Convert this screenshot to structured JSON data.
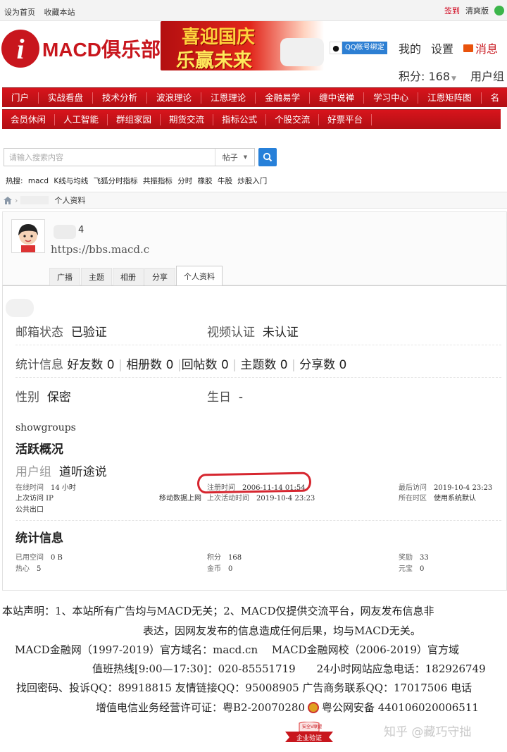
{
  "topbar": {
    "left_links": [
      "设为首页",
      "收藏本站"
    ],
    "signin": "签到",
    "theme": "清爽版"
  },
  "header": {
    "logo_letter": "i",
    "logo_text": "MACD俱乐部",
    "banner_line1": "喜迎国庆",
    "banner_line2": "乐赢未来",
    "qq_bind": "QQ帐号绑定",
    "my": "我的",
    "settings": "设置",
    "messages": "消息",
    "points": "积分: 168",
    "usergroup": "用户组"
  },
  "nav_primary": [
    "门户",
    "实战看盘",
    "技术分析",
    "波浪理论",
    "江恩理论",
    "金融易学",
    "缠中说禅",
    "学习中心",
    "江恩矩阵图",
    "名"
  ],
  "nav_secondary": [
    "会员休闲",
    "人工智能",
    "群组家园",
    "期货交流",
    "指标公式",
    "个股交流",
    "好票平台"
  ],
  "search": {
    "placeholder": "请输入搜索内容",
    "type": "帖子"
  },
  "hot": {
    "label": "热搜:",
    "words": [
      "macd",
      "K线与均线",
      "飞狐分时指标",
      "共振指标",
      "分时",
      "橡胶",
      "牛股",
      "炒股入门"
    ]
  },
  "breadcrumb": {
    "current": "个人资料"
  },
  "profile": {
    "name_suffix": "4",
    "url": "https://bbs.macd.c",
    "tabs": [
      "广播",
      "主题",
      "相册",
      "分享",
      "个人资料"
    ],
    "active_tab": "个人资料"
  },
  "details": {
    "email_label": "邮箱状态",
    "email_value": "已验证",
    "video_label": "视频认证",
    "video_value": "未认证",
    "stats_label": "统计信息",
    "stats": [
      "好友数 0",
      "相册数 0",
      "回帖数 0",
      "主题数 0",
      "分享数 0"
    ],
    "gender_label": "性别",
    "gender_value": "保密",
    "birthday_label": "生日",
    "birthday_value": "-",
    "showgroups": "showgroups",
    "activity_title": "活跃概况",
    "group_label": "用户组",
    "group_value": "道听途说",
    "online_label": "在线时间",
    "online_value": "14 小时",
    "reg_label": "注册时间",
    "reg_value": "2006-11-14 01:54",
    "last_visit_label": "最后访问",
    "last_visit_value": "2019-10-4 23:23",
    "last_ip_label": "上次访问 IP",
    "mobile_label": "移动数据上网",
    "last_active_label": "上次活动时间",
    "last_active_value": "2019-10-4 23:23",
    "region_label": "所在时区",
    "region_value": "使用系统默认",
    "public_exit": "公共出口",
    "stats_title": "统计信息",
    "space_label": "已用空间",
    "space_value": "0 B",
    "points_label": "积分",
    "points_value": "168",
    "reward_label": "奖励",
    "reward_value": "33",
    "enthusiasm_label": "热心",
    "enthusiasm_value": "5",
    "gold_label": "金币",
    "gold_value": "0",
    "treasure_label": "元宝",
    "treasure_value": "0"
  },
  "footer": {
    "line1": "本站声明：1、本站所有广告均与MACD无关；2、MACD仅提供交流平台，网友发布信息非",
    "line2": "表达，因网友发布的信息造成任何后果，均与MACD无关。",
    "line3": "MACD金融网（1997-2019）官方域名：macd.cn　 MACD金融网校（2006-2019）官方域",
    "line4": "值班热线[9:00—17:30]：020-85551719　　24小时网站应急电话：182926749",
    "line5": "找回密码、投诉QQ：89918815 友情链接QQ：95008905 广告商务联系QQ：17017506 电话",
    "line6a": "增值电信业务经营许可证：粤B2-20070280",
    "line6b": "粤公网安备 440106020006511",
    "badge_top": "安全V联盟",
    "badge_bottom": "企业验证",
    "watermark": "知乎 @藏巧守拙"
  }
}
